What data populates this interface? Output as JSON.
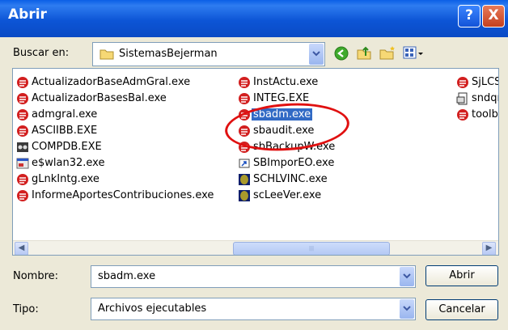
{
  "window": {
    "title": "Abrir",
    "help_glyph": "?",
    "close_glyph": "X"
  },
  "lookin": {
    "label": "Buscar en:",
    "value": "SistemasBejerman"
  },
  "files": [
    {
      "name": "ActualizadorBaseAdmGral.exe",
      "icon": "app-red-icon"
    },
    {
      "name": "ActualizadorBasesBal.exe",
      "icon": "app-red-icon"
    },
    {
      "name": "admgral.exe",
      "icon": "app-red-icon"
    },
    {
      "name": "ASCIIBB.EXE",
      "icon": "app-red-icon"
    },
    {
      "name": "COMPDB.EXE",
      "icon": "app-dark-icon"
    },
    {
      "name": "e$wlan32.exe",
      "icon": "app-window-icon"
    },
    {
      "name": "gLnkIntg.exe",
      "icon": "app-red-icon"
    },
    {
      "name": "InformeAportesContribuciones.exe",
      "icon": "app-red-icon"
    },
    {
      "name": "InstActu.exe",
      "icon": "app-red-icon"
    },
    {
      "name": "INTEG.EXE",
      "icon": "app-red-icon"
    },
    {
      "name": "sbadm.exe",
      "icon": "app-red-icon",
      "selected": true
    },
    {
      "name": "sbaudit.exe",
      "icon": "app-red-icon"
    },
    {
      "name": "sbBackupW.exe",
      "icon": "app-red-icon"
    },
    {
      "name": "SBImporEO.exe",
      "icon": "app-shortcut-icon"
    },
    {
      "name": "SCHLVINC.exe",
      "icon": "app-olive-icon"
    },
    {
      "name": "scLeeVer.exe",
      "icon": "app-olive-icon"
    },
    {
      "name": "SjLCS",
      "icon": "app-red-icon"
    },
    {
      "name": "sndqr",
      "icon": "app-generic-icon"
    },
    {
      "name": "toolba",
      "icon": "app-red-icon"
    }
  ],
  "filename": {
    "label": "Nombre:",
    "value": "sbadm.exe"
  },
  "filetype": {
    "label": "Tipo:",
    "value": "Archivos ejecutables"
  },
  "buttons": {
    "open": "Abrir",
    "cancel": "Cancelar"
  },
  "colors": {
    "selection": "#316ac5",
    "annotation": "#e01010",
    "title_bar": "#0a5fe6"
  }
}
